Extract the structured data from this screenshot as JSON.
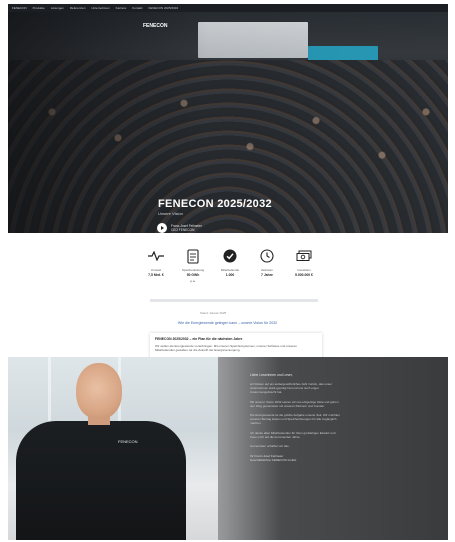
{
  "nav": {
    "items": [
      "FENECON",
      "Produkte",
      "Lösungen",
      "Referenzen",
      "Unternehmen",
      "Karriere",
      "Kontakt",
      "FENECON 2025/2032"
    ]
  },
  "hero": {
    "logo_text": "FENECON",
    "title": "FENECON 2025/2032",
    "subtitle": "Unsere Vision",
    "credit_line1": "Franz-Josef Feilmeier",
    "credit_line2": "CEO FENECON"
  },
  "stats": [
    {
      "icon": "activity-pulse-icon",
      "label": "Umsatz",
      "value": "7,5 Mrd. €"
    },
    {
      "icon": "document-icon",
      "label": "Speicherleistung",
      "value": "50 GWh",
      "extra": "p.a."
    },
    {
      "icon": "check-circle-icon",
      "label": "Mitarbeitende",
      "value": "1.000"
    },
    {
      "icon": "clock-icon",
      "label": "Zeitraum",
      "value": "7 Jahre"
    },
    {
      "icon": "banknote-icon",
      "label": "Investition",
      "value": "5.000.000 €"
    }
  ],
  "section": {
    "caption": "Stand: Januar 2025",
    "link_text": "Wie die Energiewende gelingen kann – unsere Vision für 2032"
  },
  "info_card": {
    "title": "FENECON 2025/2032 – ein Plan für die nächsten Jahre",
    "text": "Wir wollen die Energiewende voranbringen. Mit unseren Speichersystemen, unserer Software und unseren Mitarbeitenden gestalten wir die Zukunft der Energieversorgung."
  },
  "bottom": {
    "shirt_logo": "FENECON",
    "heading": "Liebe Leserinnen und Leser,",
    "paragraphs": [
      "wir blicken auf ein außergewöhnliches Jahr zurück, das unser Unternehmen stark geprägt hat und uns noch enger zusammengebracht hat.",
      "Mit unserer Vision 2032 setzen wir uns ehrgeizige Ziele und gehen den Weg gemeinsam mit unseren Partnern und Kunden.",
      "Die Energiewende ist die größte Aufgabe unserer Zeit. Wir möchten unseren Beitrag leisten und Speicherlösungen für alle zugänglich machen.",
      "Ich danke allen Mitarbeitenden für ihren großartigen Einsatz und freue mich auf die kommenden Jahre.",
      "Gemeinsam schaffen wir das."
    ],
    "sign_line1": "Ihr Franz-Josef Feilmeier",
    "sign_line2": "Geschäftsführer FENECON GmbH"
  }
}
